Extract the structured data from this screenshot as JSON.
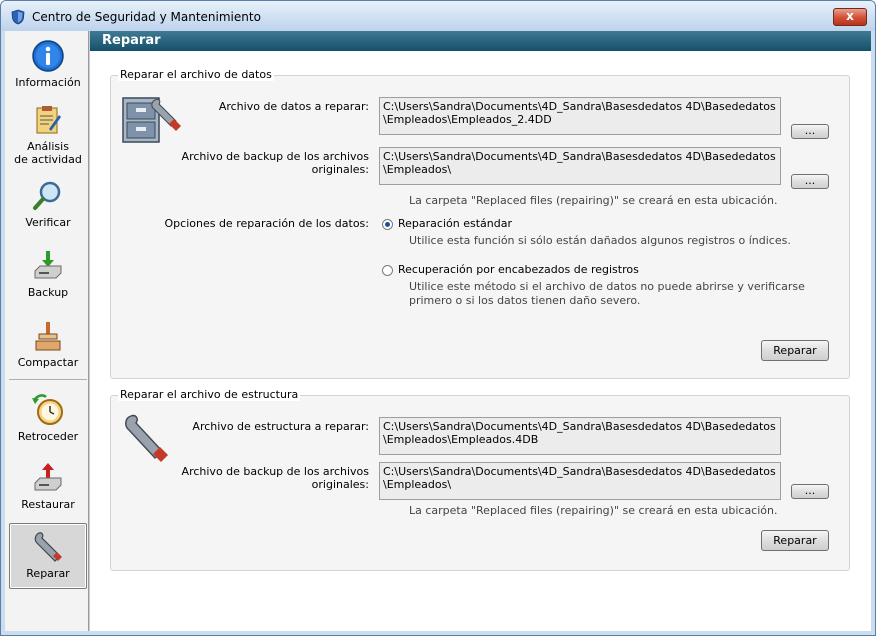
{
  "window": {
    "title": "Centro de Seguridad y Mantenimiento",
    "close": "x"
  },
  "sidebar": {
    "items": [
      {
        "label": "Información",
        "icon": "info-icon"
      },
      {
        "label": "Análisis\nde actividad",
        "icon": "activity-analysis-icon"
      },
      {
        "label": "Verificar",
        "icon": "magnifier-icon"
      },
      {
        "label": "Backup",
        "icon": "backup-drive-icon"
      },
      {
        "label": "Compactar",
        "icon": "compact-icon"
      },
      {
        "label": "Retroceder",
        "icon": "rollback-clock-icon"
      },
      {
        "label": "Restaurar",
        "icon": "restore-drive-icon"
      },
      {
        "label": "Reparar",
        "icon": "wrench-icon"
      }
    ],
    "selected": "Reparar"
  },
  "header": {
    "title": "Reparar"
  },
  "data_section": {
    "title": "Reparar el archivo de datos",
    "file_label": "Archivo de datos a reparar:",
    "file_path": "C:\\Users\\Sandra\\Documents\\4D_Sandra\\Basesdedatos 4D\\Basededatos\n\\Empleados\\Empleados_2.4DD",
    "browse1": "...",
    "backup_label": "Archivo de backup de los archivos\noriginales:",
    "backup_path": "C:\\Users\\Sandra\\Documents\\4D_Sandra\\Basesdedatos 4D\\Basededatos\n\\Empleados\\",
    "browse2": "...",
    "folder_hint": "La carpeta \"Replaced files (repairing)\" se creará en esta ubicación.",
    "options_label": "Opciones de reparación de los datos:",
    "option_standard": "Reparación estándar",
    "option_standard_hint": "Utilice esta función si sólo están dañados algunos registros o índices.",
    "option_headers": "Recuperación por encabezados de registros",
    "option_headers_hint": "Utilice este método si el archivo de datos no puede abrirse y verificarse\nprimero o si los datos tienen daño severo.",
    "repair_button": "Reparar"
  },
  "structure_section": {
    "title": "Reparar el archivo de estructura",
    "file_label": "Archivo de estructura a reparar:",
    "file_path": "C:\\Users\\Sandra\\Documents\\4D_Sandra\\Basesdedatos 4D\\Basededatos\n\\Empleados\\Empleados.4DB",
    "backup_label": "Archivo de backup de los archivos\noriginales:",
    "backup_path": "C:\\Users\\Sandra\\Documents\\4D_Sandra\\Basesdedatos 4D\\Basededatos\n\\Empleados\\",
    "browse": "...",
    "folder_hint": "La carpeta \"Replaced files (repairing)\" se creará en esta ubicación.",
    "repair_button": "Reparar"
  }
}
